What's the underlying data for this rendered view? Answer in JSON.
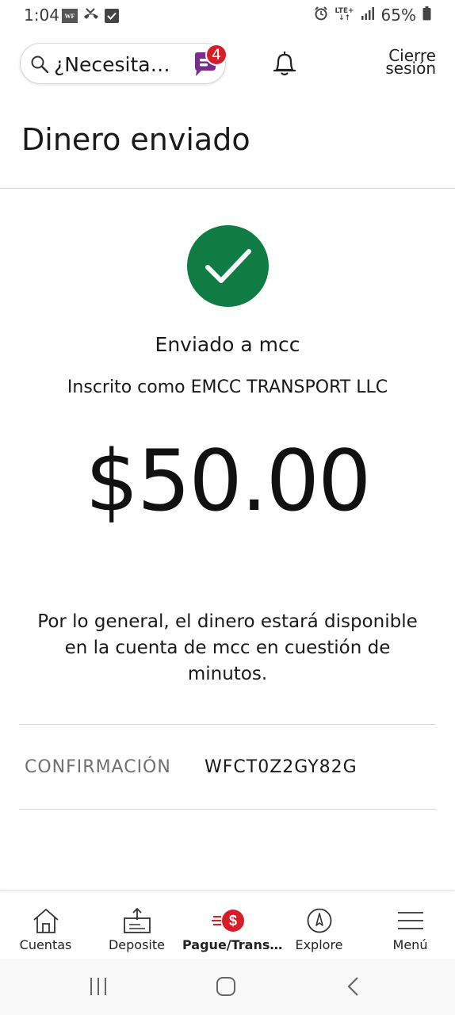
{
  "status_bar": {
    "time": "1:04",
    "wf_badge": "WF",
    "battery": "65%",
    "network": "LTE+",
    "icons": [
      "wf-icon",
      "missed-call-icon",
      "check-box-icon",
      "alarm-icon",
      "lte-icon",
      "signal-icon",
      "battery-icon"
    ]
  },
  "header": {
    "search_placeholder": "¿Necesita…",
    "chat_badge_count": "4",
    "logout_line1": "Cierre",
    "logout_line2": "sesión"
  },
  "page": {
    "title": "Dinero enviado"
  },
  "confirmation": {
    "sent_to": "Enviado a mcc",
    "enrolled_as": "Inscrito como EMCC TRANSPORT LLC",
    "amount": "$50.00",
    "note": "Por lo general, el dinero estará disponible en la cuenta de mcc en cuestión de minutos.",
    "label": "CONFIRMACIÓN",
    "number": "WFCT0Z2GY82G"
  },
  "bottom_nav": {
    "items": [
      {
        "label": "Cuentas",
        "icon": "home-icon"
      },
      {
        "label": "Deposite",
        "icon": "deposit-icon"
      },
      {
        "label": "Pague/Trans…",
        "icon": "pay-transfer-icon",
        "active": true
      },
      {
        "label": "Explore",
        "icon": "compass-icon"
      },
      {
        "label": "Menú",
        "icon": "menu-icon"
      }
    ]
  },
  "colors": {
    "success_green": "#0e7c43",
    "brand_red": "#d71e28",
    "chat_purple": "#7b2d8e"
  }
}
